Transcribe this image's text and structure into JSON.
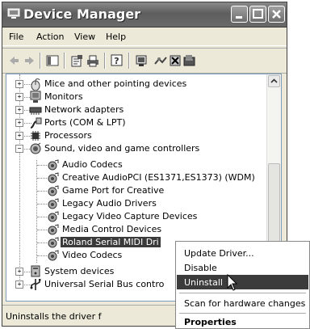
{
  "window": {
    "title": "Device Manager"
  },
  "menubar": {
    "items": [
      "File",
      "Action",
      "View",
      "Help"
    ]
  },
  "toolbar": {
    "icons": [
      "back-arrow-icon",
      "forward-arrow-icon",
      "console-tree-icon",
      "properties-icon",
      "print-icon",
      "help-icon",
      "scan-hardware-icon",
      "update-driver-icon",
      "uninstall-icon",
      "disable-icon"
    ]
  },
  "tree": {
    "categories": [
      {
        "label": "Mice and other pointing devices",
        "expanded": false
      },
      {
        "label": "Monitors",
        "expanded": false
      },
      {
        "label": "Network adapters",
        "expanded": false
      },
      {
        "label": "Ports (COM & LPT)",
        "expanded": false
      },
      {
        "label": "Processors",
        "expanded": false
      },
      {
        "label": "Sound, video and game controllers",
        "expanded": true
      }
    ],
    "sound_children": [
      "Audio Codecs",
      "Creative AudioPCI (ES1371,ES1373) (WDM)",
      "Game Port for Creative",
      "Legacy Audio Drivers",
      "Legacy Video Capture Devices",
      "Media Control Devices",
      "Roland Serial MIDI Dri",
      "Video Codecs"
    ],
    "selected": "Roland Serial MIDI Dri",
    "tail_categories": [
      "System devices",
      "Universal Serial Bus contro"
    ]
  },
  "status": {
    "text": "Uninstalls the driver f"
  },
  "context_menu": {
    "items": [
      "Update Driver...",
      "Disable",
      "Uninstall",
      "Scan for hardware changes",
      "Properties"
    ],
    "highlighted": "Uninstall"
  }
}
